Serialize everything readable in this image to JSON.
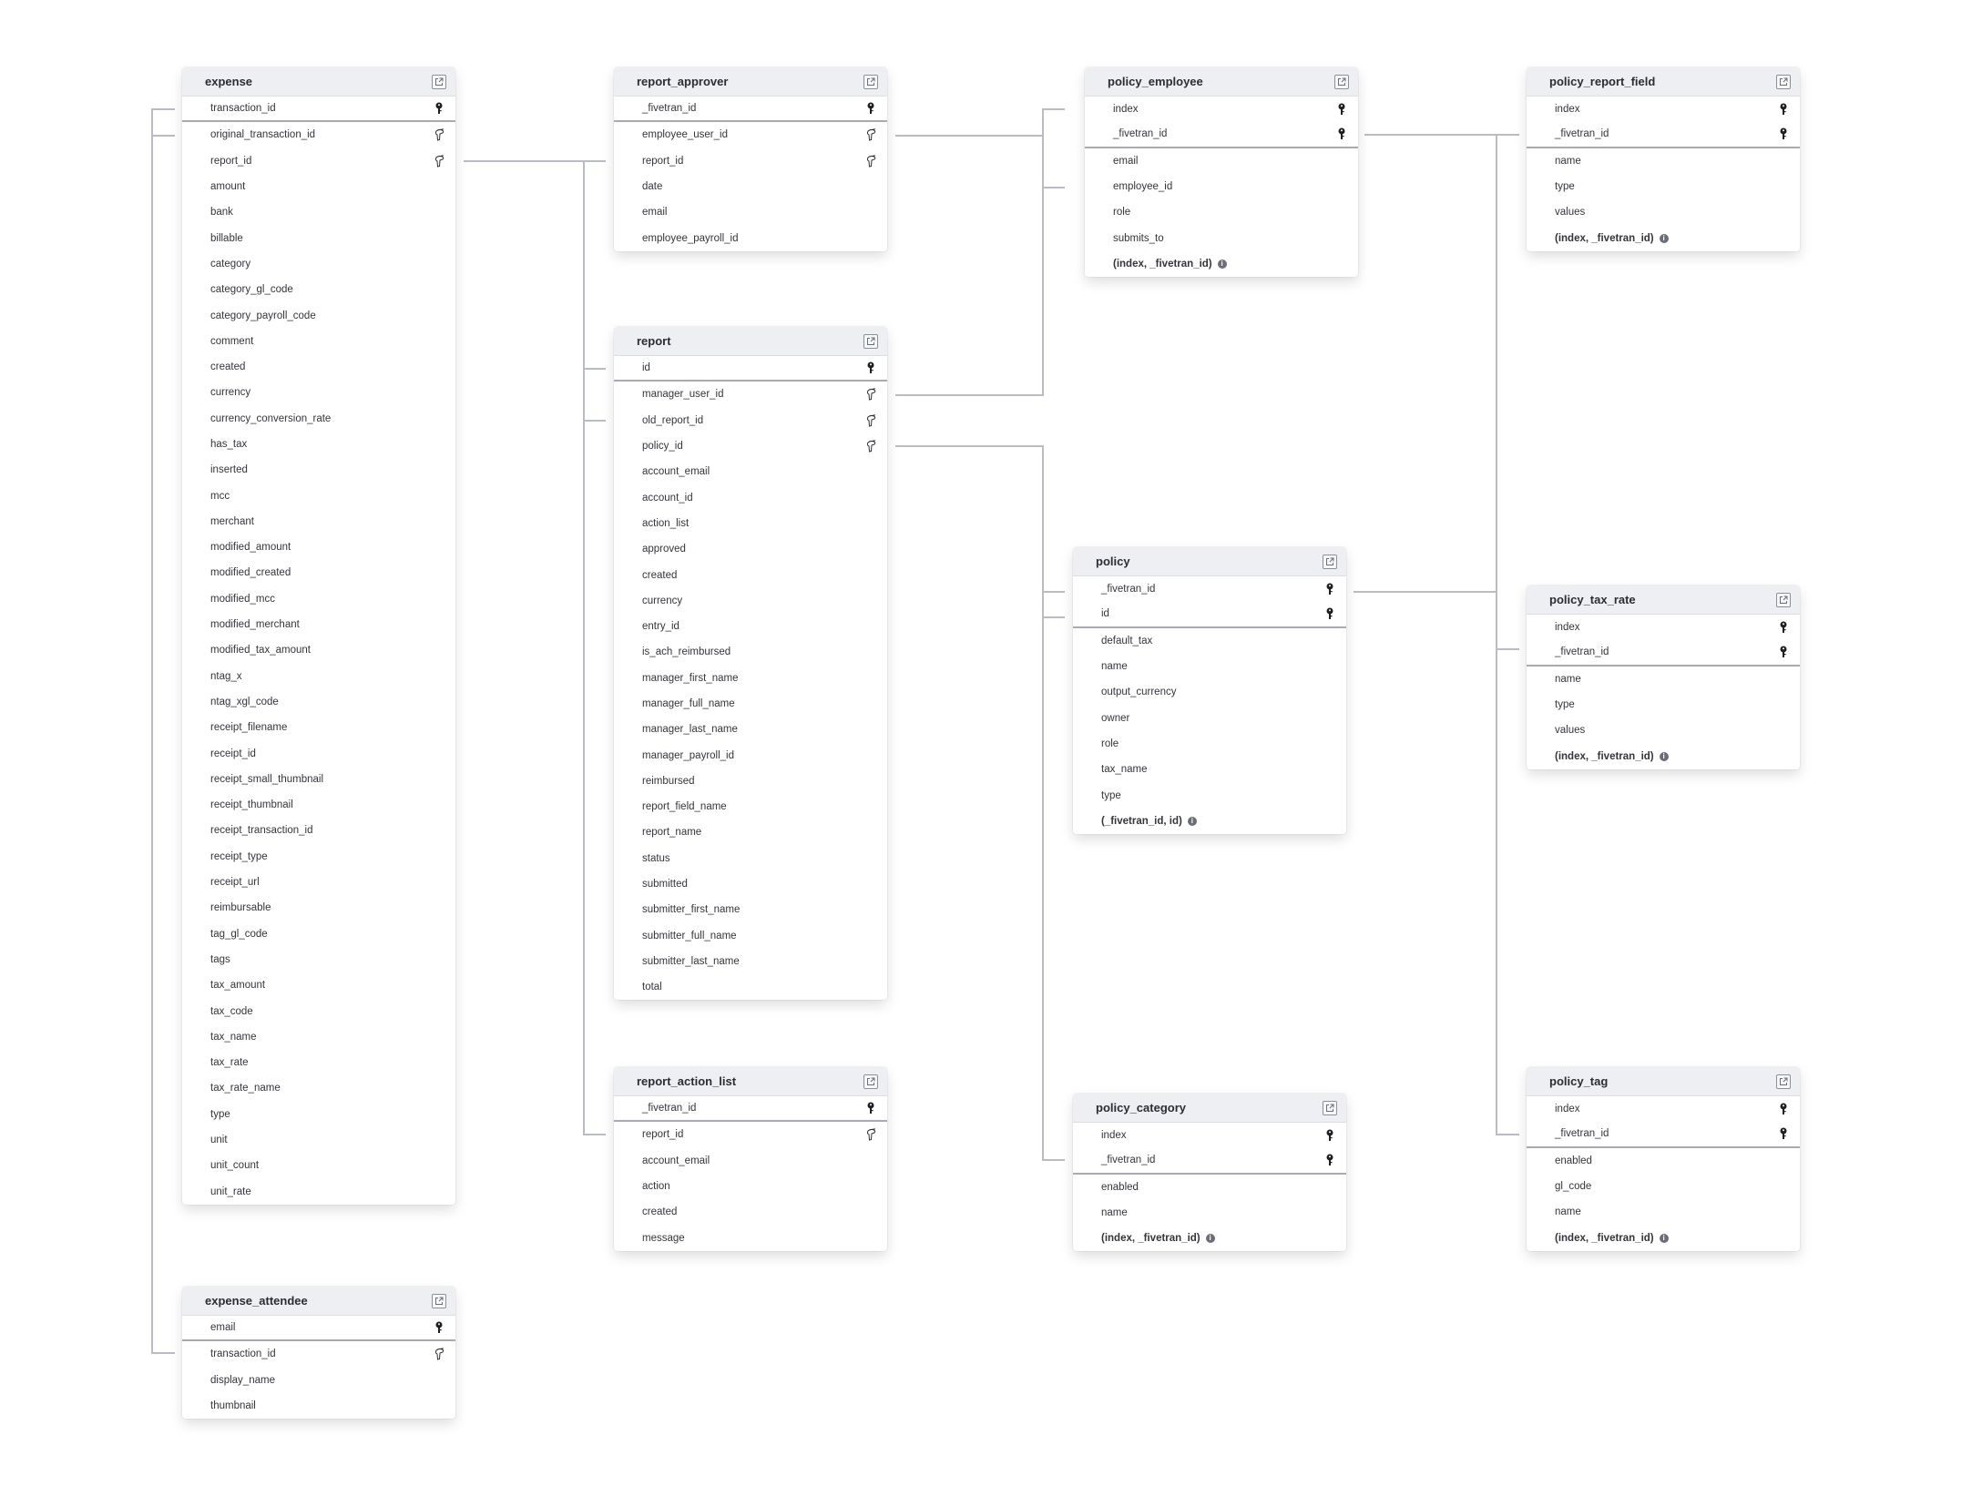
{
  "diagram": {
    "type": "entity-relationship",
    "tables": [
      {
        "id": "expense",
        "name": "expense",
        "columns": [
          {
            "name": "transaction_id",
            "key": "pk"
          },
          {
            "name": "original_transaction_id",
            "key": "fk"
          },
          {
            "name": "report_id",
            "key": "fk"
          },
          {
            "name": "amount"
          },
          {
            "name": "bank"
          },
          {
            "name": "billable"
          },
          {
            "name": "category"
          },
          {
            "name": "category_gl_code"
          },
          {
            "name": "category_payroll_code"
          },
          {
            "name": "comment"
          },
          {
            "name": "created"
          },
          {
            "name": "currency"
          },
          {
            "name": "currency_conversion_rate"
          },
          {
            "name": "has_tax"
          },
          {
            "name": "inserted"
          },
          {
            "name": "mcc"
          },
          {
            "name": "merchant"
          },
          {
            "name": "modified_amount"
          },
          {
            "name": "modified_created"
          },
          {
            "name": "modified_mcc"
          },
          {
            "name": "modified_merchant"
          },
          {
            "name": "modified_tax_amount"
          },
          {
            "name": "ntag_x"
          },
          {
            "name": "ntag_xgl_code"
          },
          {
            "name": "receipt_filename"
          },
          {
            "name": "receipt_id"
          },
          {
            "name": "receipt_small_thumbnail"
          },
          {
            "name": "receipt_thumbnail"
          },
          {
            "name": "receipt_transaction_id"
          },
          {
            "name": "receipt_type"
          },
          {
            "name": "receipt_url"
          },
          {
            "name": "reimbursable"
          },
          {
            "name": "tag_gl_code"
          },
          {
            "name": "tags"
          },
          {
            "name": "tax_amount"
          },
          {
            "name": "tax_code"
          },
          {
            "name": "tax_name"
          },
          {
            "name": "tax_rate"
          },
          {
            "name": "tax_rate_name"
          },
          {
            "name": "type"
          },
          {
            "name": "unit"
          },
          {
            "name": "unit_count"
          },
          {
            "name": "unit_rate"
          }
        ]
      },
      {
        "id": "expense_attendee",
        "name": "expense_attendee",
        "columns": [
          {
            "name": "email",
            "key": "pk"
          },
          {
            "name": "transaction_id",
            "key": "fk"
          },
          {
            "name": "display_name"
          },
          {
            "name": "thumbnail"
          }
        ]
      },
      {
        "id": "report_approver",
        "name": "report_approver",
        "columns": [
          {
            "name": "_fivetran_id",
            "key": "pk"
          },
          {
            "name": "employee_user_id",
            "key": "fk"
          },
          {
            "name": "report_id",
            "key": "fk"
          },
          {
            "name": "date"
          },
          {
            "name": "email"
          },
          {
            "name": "employee_payroll_id"
          }
        ]
      },
      {
        "id": "report",
        "name": "report",
        "columns": [
          {
            "name": "id",
            "key": "pk"
          },
          {
            "name": "manager_user_id",
            "key": "fk"
          },
          {
            "name": "old_report_id",
            "key": "fk"
          },
          {
            "name": "policy_id",
            "key": "fk"
          },
          {
            "name": "account_email"
          },
          {
            "name": "account_id"
          },
          {
            "name": "action_list"
          },
          {
            "name": "approved"
          },
          {
            "name": "created"
          },
          {
            "name": "currency"
          },
          {
            "name": "entry_id"
          },
          {
            "name": "is_ach_reimbursed"
          },
          {
            "name": "manager_first_name"
          },
          {
            "name": "manager_full_name"
          },
          {
            "name": "manager_last_name"
          },
          {
            "name": "manager_payroll_id"
          },
          {
            "name": "reimbursed"
          },
          {
            "name": "report_field_name"
          },
          {
            "name": "report_name"
          },
          {
            "name": "status"
          },
          {
            "name": "submitted"
          },
          {
            "name": "submitter_first_name"
          },
          {
            "name": "submitter_full_name"
          },
          {
            "name": "submitter_last_name"
          },
          {
            "name": "total"
          }
        ]
      },
      {
        "id": "report_action_list",
        "name": "report_action_list",
        "columns": [
          {
            "name": "_fivetran_id",
            "key": "pk"
          },
          {
            "name": "report_id",
            "key": "fk"
          },
          {
            "name": "account_email"
          },
          {
            "name": "action"
          },
          {
            "name": "created"
          },
          {
            "name": "message"
          }
        ]
      },
      {
        "id": "policy_employee",
        "name": "policy_employee",
        "columns": [
          {
            "name": "index",
            "key": "pk"
          },
          {
            "name": "_fivetran_id",
            "key": "pk"
          },
          {
            "name": "email"
          },
          {
            "name": "employee_id"
          },
          {
            "name": "role"
          },
          {
            "name": "submits_to"
          },
          {
            "name": "(index, _fivetran_id)",
            "composite": true
          }
        ]
      },
      {
        "id": "policy",
        "name": "policy",
        "columns": [
          {
            "name": "_fivetran_id",
            "key": "pk"
          },
          {
            "name": "id",
            "key": "pk"
          },
          {
            "name": "default_tax"
          },
          {
            "name": "name"
          },
          {
            "name": "output_currency"
          },
          {
            "name": "owner"
          },
          {
            "name": "role"
          },
          {
            "name": "tax_name"
          },
          {
            "name": "type"
          },
          {
            "name": "(_fivetran_id, id)",
            "composite": true
          }
        ]
      },
      {
        "id": "policy_category",
        "name": "policy_category",
        "columns": [
          {
            "name": "index",
            "key": "pk"
          },
          {
            "name": "_fivetran_id",
            "key": "pk"
          },
          {
            "name": "enabled"
          },
          {
            "name": "name"
          },
          {
            "name": "(index, _fivetran_id)",
            "composite": true
          }
        ]
      },
      {
        "id": "policy_report_field",
        "name": "policy_report_field",
        "columns": [
          {
            "name": "index",
            "key": "pk"
          },
          {
            "name": "_fivetran_id",
            "key": "pk"
          },
          {
            "name": "name"
          },
          {
            "name": "type"
          },
          {
            "name": "values"
          },
          {
            "name": "(index, _fivetran_id)",
            "composite": true
          }
        ]
      },
      {
        "id": "policy_tax_rate",
        "name": "policy_tax_rate",
        "columns": [
          {
            "name": "index",
            "key": "pk"
          },
          {
            "name": "_fivetran_id",
            "key": "pk"
          },
          {
            "name": "name"
          },
          {
            "name": "type"
          },
          {
            "name": "values"
          },
          {
            "name": "(index, _fivetran_id)",
            "composite": true
          }
        ]
      },
      {
        "id": "policy_tag",
        "name": "policy_tag",
        "columns": [
          {
            "name": "index",
            "key": "pk"
          },
          {
            "name": "_fivetran_id",
            "key": "pk"
          },
          {
            "name": "enabled"
          },
          {
            "name": "gl_code"
          },
          {
            "name": "name"
          },
          {
            "name": "(index, _fivetran_id)",
            "composite": true
          }
        ]
      }
    ],
    "relationships": [
      {
        "from": "expense.original_transaction_id",
        "to": "expense.transaction_id"
      },
      {
        "from": "expense_attendee.transaction_id",
        "to": "expense.transaction_id"
      },
      {
        "from": "expense.report_id",
        "to": "report.id"
      },
      {
        "from": "report_approver.report_id",
        "to": "report.id"
      },
      {
        "from": "report.old_report_id",
        "to": "report.id"
      },
      {
        "from": "report_action_list.report_id",
        "to": "report.id"
      },
      {
        "from": "report_approver.employee_user_id",
        "to": "policy_employee"
      },
      {
        "from": "report.manager_user_id",
        "to": "policy_employee"
      },
      {
        "from": "report.policy_id",
        "to": "policy"
      },
      {
        "from": "policy_category._fivetran_id",
        "to": "policy"
      },
      {
        "from": "policy_employee._fivetran_id",
        "to": "policy_report_field"
      },
      {
        "from": "policy._fivetran_id",
        "to": "policy_tax_rate"
      },
      {
        "from": "policy_tag._fivetran_id",
        "to": "policy_report_field"
      }
    ],
    "icons": {
      "pk": "key-icon",
      "fk": "foreign-key-icon",
      "open": "open-external-icon",
      "info": "info-icon"
    },
    "colors": {
      "header_bg": "#eeeff2",
      "connector": "#b9bcc3",
      "text": "#2b2d33"
    }
  }
}
